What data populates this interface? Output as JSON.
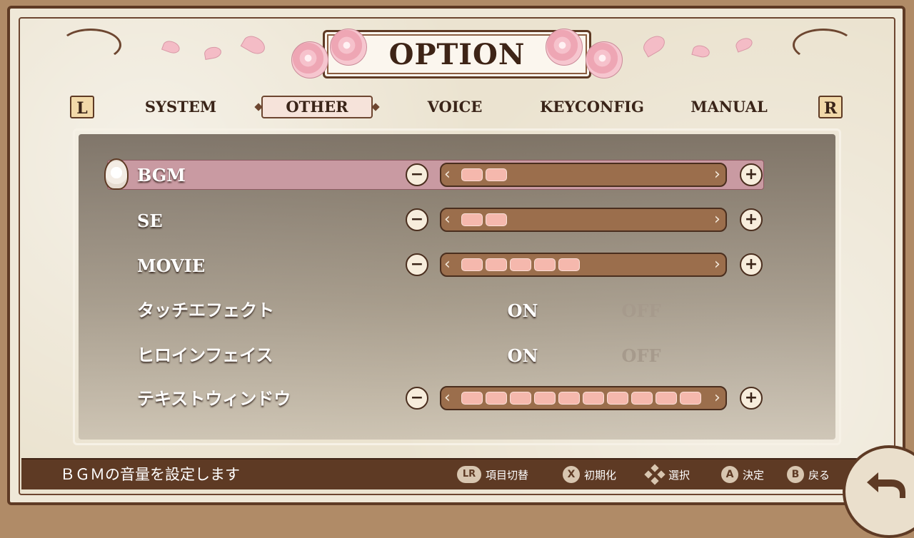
{
  "title": "OPTION",
  "shoulders": {
    "left": "L",
    "right": "R"
  },
  "tabs": [
    {
      "label": "SYSTEM",
      "active": false
    },
    {
      "label": "OTHER",
      "active": true
    },
    {
      "label": "VOICE",
      "active": false
    },
    {
      "label": "KEYCONFIG",
      "active": false
    },
    {
      "label": "MANUAL",
      "active": false
    }
  ],
  "settings": [
    {
      "label": "BGM",
      "type": "slider",
      "level": 2,
      "max": 10,
      "selected": true
    },
    {
      "label": "SE",
      "type": "slider",
      "level": 2,
      "max": 10
    },
    {
      "label": "MOVIE",
      "type": "slider",
      "level": 5,
      "max": 10
    },
    {
      "label": "タッチエフェクト",
      "type": "toggle",
      "on_label": "ON",
      "off_label": "OFF",
      "value": "ON"
    },
    {
      "label": "ヒロインフェイス",
      "type": "toggle",
      "on_label": "ON",
      "off_label": "OFF",
      "value": "ON"
    },
    {
      "label": "テキストウィンドウ",
      "type": "slider",
      "level": 10,
      "max": 10
    }
  ],
  "controls": {
    "minus": "−",
    "plus": "+",
    "cap_left": "‹",
    "cap_right": "›"
  },
  "help_text": "ＢＧＭの音量を設定します",
  "hints": [
    {
      "button": "LR",
      "label": "項目切替"
    },
    {
      "button": "X",
      "label": "初期化"
    },
    {
      "button": "dpad",
      "label": "選択"
    },
    {
      "button": "A",
      "label": "決定"
    },
    {
      "button": "B",
      "label": "戻る"
    }
  ],
  "colors": {
    "frame_brown": "#5e3a24",
    "highlight_pink": "#c99aa2",
    "segment_pink": "#f5b8ad",
    "track_brown": "#9b6e4c"
  }
}
